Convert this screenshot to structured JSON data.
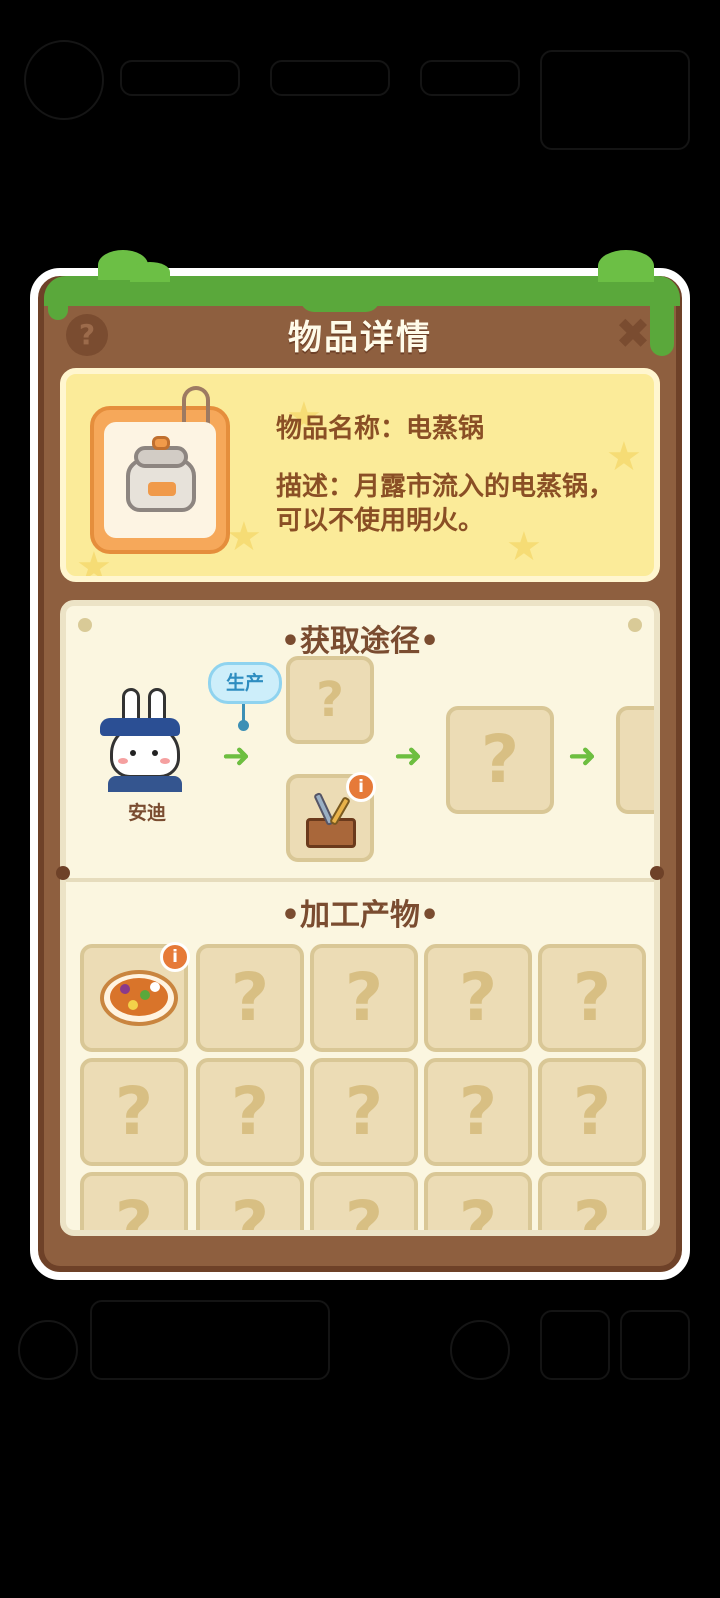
{
  "dialog": {
    "title": "物品详情",
    "help_icon": "question-icon",
    "close_icon": "close-icon"
  },
  "item": {
    "name_line": "物品名称：电蒸锅",
    "description_line": "描述：月露市流入的电蒸锅，可以不使用明火。",
    "icon": "electric-steamer-icon"
  },
  "acquisition": {
    "section_title": "•获取途径•",
    "character_name": "安迪",
    "produce_label": "生产",
    "unknown_mark": "?",
    "info_mark": "i",
    "arrow": "➜"
  },
  "products": {
    "section_title": "•加工产物•",
    "unknown_mark": "?",
    "info_mark": "i"
  },
  "colors": {
    "frame_brown": "#8e5f3f",
    "grass_green": "#5aa83b",
    "card_yellow": "#fbeb99",
    "text_brown": "#8a4f25",
    "arrow_green": "#6dbf3f",
    "badge_orange": "#e67a39",
    "bubble_blue": "#cdeefa"
  }
}
